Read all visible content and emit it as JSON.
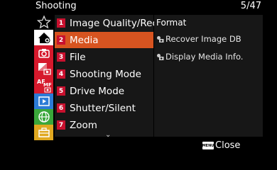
{
  "header": {
    "title": "Shooting",
    "page_indicator": "5/47"
  },
  "sidebar": {
    "tabs": [
      {
        "icon": "star-icon",
        "color": "#ffffff"
      },
      {
        "icon": "my-menu-icon",
        "color": "#9a6fb5"
      },
      {
        "icon": "camera-icon",
        "color": "#d6192c"
      },
      {
        "icon": "exposure-color-icon",
        "color": "#d6192c"
      },
      {
        "icon": "af-mf-icon",
        "color": "#d6192c"
      },
      {
        "icon": "playback-icon",
        "color": "#2b7bd6"
      },
      {
        "icon": "network-icon",
        "color": "#3aa73a"
      },
      {
        "icon": "toolbox-icon",
        "color": "#e0a820"
      }
    ],
    "active_index": 1
  },
  "menu": {
    "items": [
      {
        "num": "1",
        "label": "Image Quality/Rec"
      },
      {
        "num": "2",
        "label": "Media"
      },
      {
        "num": "3",
        "label": "File"
      },
      {
        "num": "4",
        "label": "Shooting Mode"
      },
      {
        "num": "5",
        "label": "Drive Mode"
      },
      {
        "num": "6",
        "label": "Shutter/Silent"
      },
      {
        "num": "7",
        "label": "Zoom"
      }
    ],
    "selected_index": 1,
    "more_indicator": "⌄",
    "accent": "#d75420"
  },
  "detail": {
    "header": "Format",
    "items": [
      {
        "label": "Recover Image DB",
        "icon": "camera-small-icon"
      },
      {
        "label": "Display Media Info.",
        "icon": "camera-small-icon"
      }
    ]
  },
  "footer": {
    "menu_key": "MENU",
    "close_label": "Close"
  }
}
